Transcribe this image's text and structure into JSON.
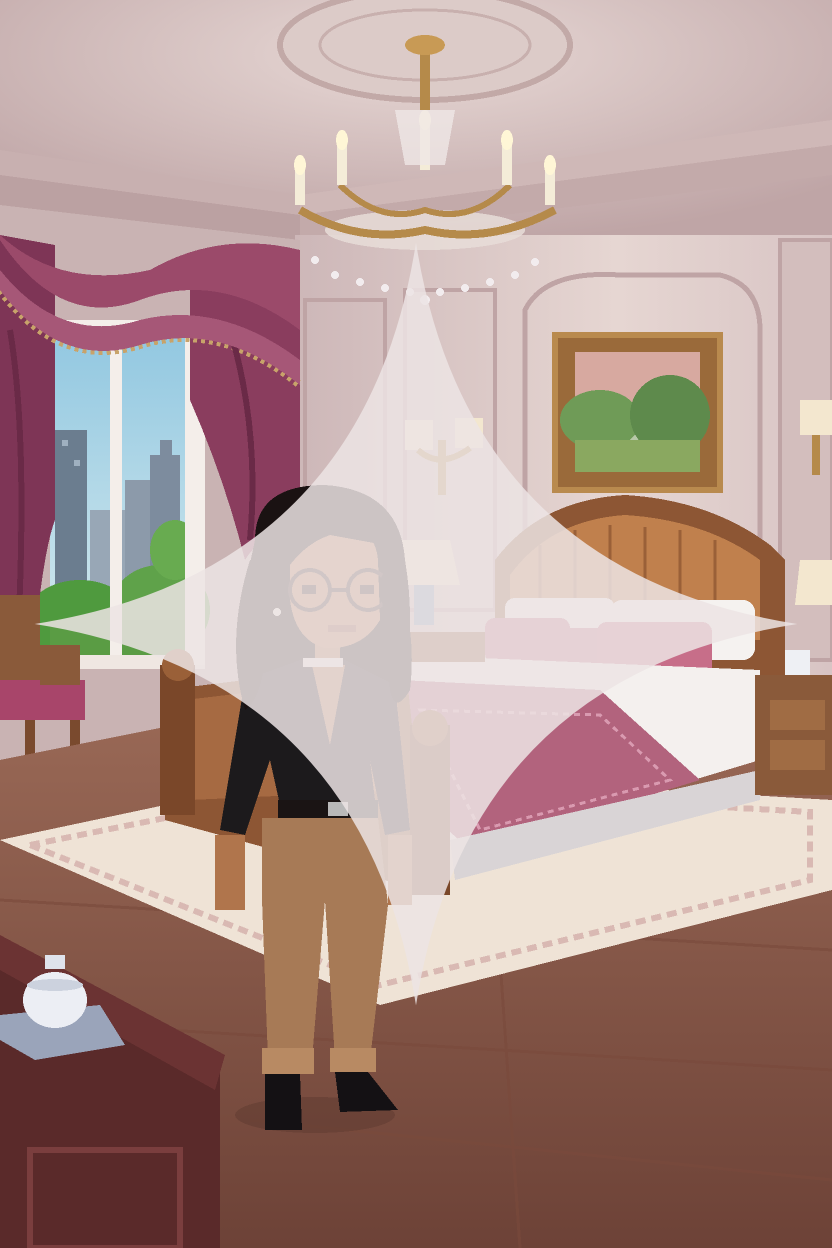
{
  "scene": {
    "setting": "bedroom",
    "colors": {
      "wall": "#d8c4c4",
      "ceiling": "#cdb6b4",
      "curtain": "#8a3d5e",
      "floor": "#8b5a4a",
      "rug": "#efe3d6",
      "bed_wood": "#8d5634",
      "bedspread": "#b2637d",
      "character_shirt": "#1c1a1c",
      "character_pants": "#a77a56",
      "character_hair": "#1a1212",
      "sky": "#a9d3e6",
      "trees": "#5fa24a"
    }
  },
  "ui": {
    "sparkle_icon": "sparkle-icon"
  }
}
